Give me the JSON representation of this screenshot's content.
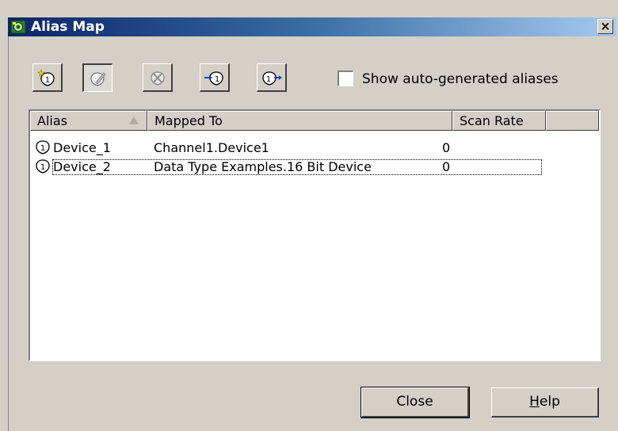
{
  "window": {
    "title": "Alias Map",
    "close_glyph": "×"
  },
  "toolbar": {
    "buttons": [
      {
        "icon": "new-alias-icon",
        "state": "normal"
      },
      {
        "icon": "edit-alias-icon",
        "state": "pressed"
      },
      {
        "icon": "delete-alias-icon",
        "state": "disabled"
      },
      {
        "icon": "import-alias-icon",
        "state": "normal"
      },
      {
        "icon": "export-alias-icon",
        "state": "normal"
      }
    ],
    "show_auto_label": "Show auto-generated aliases",
    "show_auto_checked": false
  },
  "list": {
    "columns": [
      "Alias",
      "Mapped To",
      "Scan Rate"
    ],
    "rows": [
      {
        "alias": "Device_1",
        "mapped_to": "Channel1.Device1",
        "scan_rate": "0"
      },
      {
        "alias": "Device_2",
        "mapped_to": "Data Type Examples.16 Bit Device",
        "scan_rate": "0"
      }
    ]
  },
  "buttons": {
    "close_label": "Close",
    "help_mnemonic": "H",
    "help_rest": "elp"
  },
  "colors": {
    "dialog_bg": "#d4d0c8",
    "title_start": "#0a246a",
    "title_end": "#a6caf0"
  }
}
